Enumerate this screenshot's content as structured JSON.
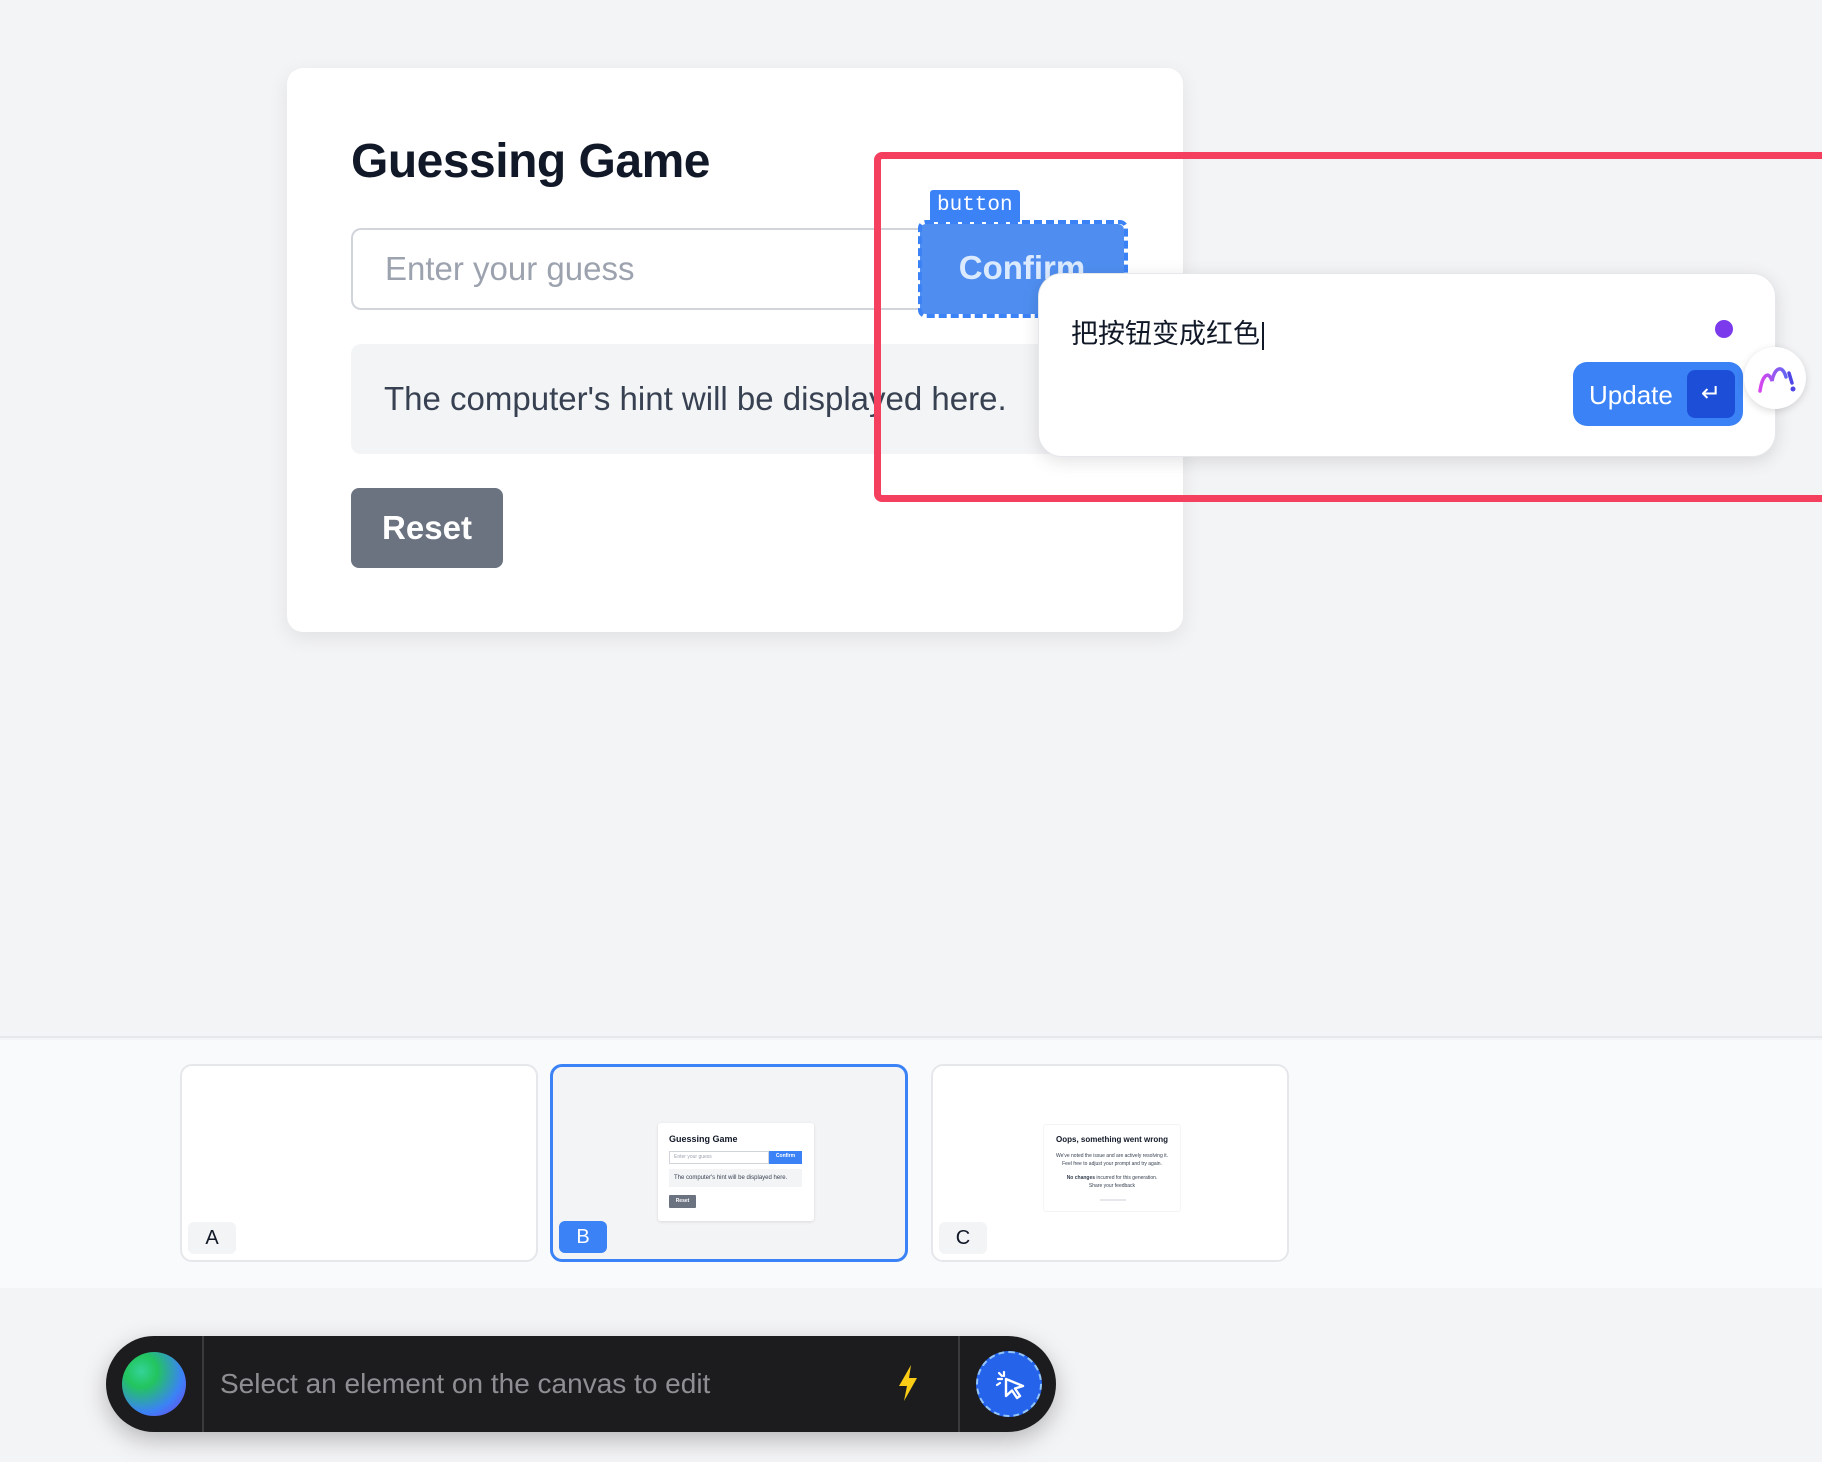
{
  "game": {
    "title": "Guessing Game",
    "input_placeholder": "Enter your guess",
    "confirm_label": "Confirm",
    "hint_text": "The computer's hint will be displayed here.",
    "reset_label": "Reset"
  },
  "selection": {
    "element_tag": "button"
  },
  "edit_popover": {
    "prompt_text": "把按钮变成红色",
    "update_label": "Update",
    "enter_key_glyph": "↵",
    "status_dot_color": "#7c3aed"
  },
  "versions": {
    "items": [
      {
        "label": "A",
        "selected": false
      },
      {
        "label": "B",
        "selected": true,
        "preview": {
          "title": "Guessing Game",
          "input_placeholder": "Enter your guess",
          "confirm_label": "Confirm",
          "hint_text": "The computer's hint will be displayed here.",
          "reset_label": "Reset"
        }
      },
      {
        "label": "C",
        "selected": false,
        "preview": {
          "heading": "Oops, something went wrong",
          "line1": "We've noted the issue and are actively resolving it.",
          "line2": "Feel free to adjust your prompt and try again.",
          "line3_bold": "No changes",
          "line3_rest": "incurred for this generation.",
          "line4": "Share your feedback"
        }
      }
    ]
  },
  "prompt_bar": {
    "placeholder": "Select an element on the canvas to edit"
  },
  "colors": {
    "accent": "#3b82f6",
    "highlight": "#f43f5e",
    "reset_button": "#6b7280",
    "bolt": "#facc15"
  }
}
